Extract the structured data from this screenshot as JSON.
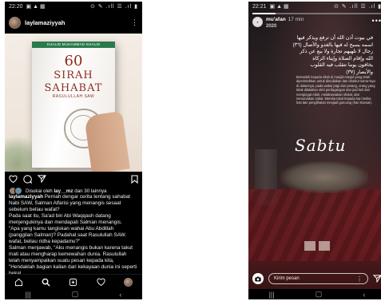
{
  "left_phone": {
    "status_time": "22:20",
    "status_right": "⊙ ✎ .ıll ☰ .ıl ▮",
    "username": "laylamaziyyah",
    "book": {
      "author": "KHALID MUHAMMAD KHALID",
      "number": "60",
      "title_1": "SIRAH",
      "title_2": "SAHABAT",
      "title_3": "RASULULLAH SAW"
    },
    "liked_by": "Disukai oleh ",
    "liked_user": "lay__mz",
    "liked_rest": " dan 30 lainnya",
    "caption_user": "laylamaziyyah",
    "caption_lines": [
      " Pernah dengar cerita tentang sahabat Nabi SAW, Salman Alfarisi yang menangis sesaat sebelum beliau wafat?",
      "Pada saat itu, Sa'ad bin Abi Waqqash datang menjengukinya dan mendapati Salman menangis.",
      "\"Apa yang kamu tangiskan wahai Abu Abdillah (panggilan Salman)? Padahal saat Rasulullah SAW. wafat, beliau ridha kepadamu?\"",
      "Salman menjawab, \"Aku menangis bukan karena takut mati atau mengharap kemewahan dunia. Rasulullah telah menyampaikan suatu pesan kepada kita,",
      "\"Hendaklah bagian kalian dari kekayaan dunia ini seperti bekal..."
    ]
  },
  "right_phone": {
    "status_time": "22:21",
    "status_right": "⊙ ✎ .ıll ☰ .ıl ▮",
    "progress": 0.18,
    "story_user": "mu'afan",
    "story_time": "17 min",
    "story_year": "2020",
    "arabic_lines": [
      "في بيوت أذن الله أن ترفع ويذكر فيها",
      "اسمه يسبح له فيها بالغدو والآصال (٣٦)",
      "رجال لا تلهيهم تجارة ولا بيع عن ذكر",
      "الله وإقام الصلاة وإيتاء الزكاة",
      "يخافون يوما تتقلب فيه القلوب",
      "والأبصار (٣٧)"
    ],
    "translation": "Bertasbih kepada Allah di masjid-masjid yang telah diperintahkan untuk dimuliakan dan disebut nama-Nya di dalamnya, pada waktu pagi dan petang, orang yang tidak dilalaikan oleh perdagangan dan jual beli dari mengingat Allah, melaksanakan shalat, dan menunaikan zakat. Mereka takut kepada hari ketika hati dan penglihatan menjadi guncang (hari Kiamat).",
    "day_label": "Sabtu",
    "message_placeholder": "Kirim pesan"
  }
}
